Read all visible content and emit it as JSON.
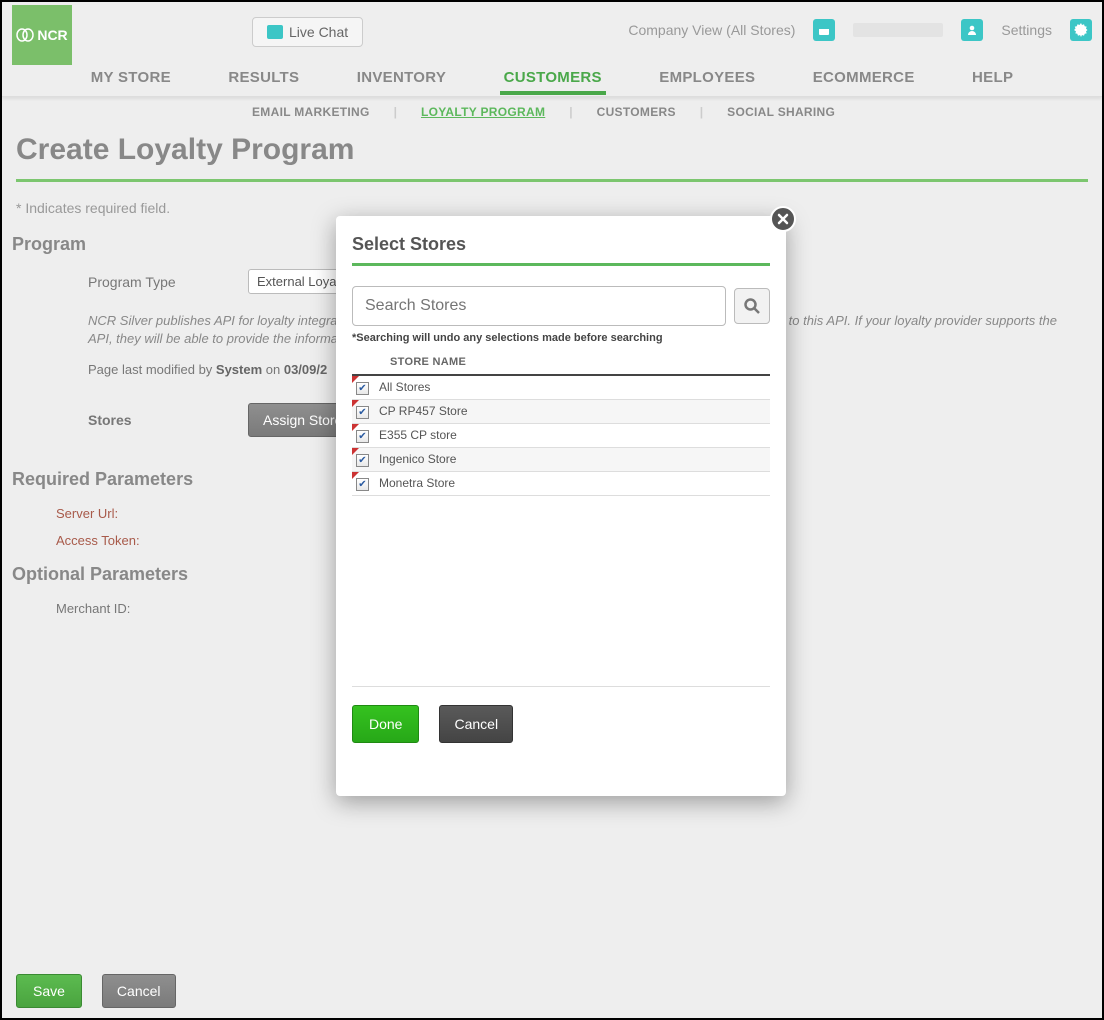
{
  "brand": "NCR",
  "live_chat_label": "Live Chat",
  "top": {
    "company_view": "Company View (All Stores)",
    "settings": "Settings"
  },
  "main_nav": {
    "items": [
      "MY STORE",
      "RESULTS",
      "INVENTORY",
      "CUSTOMERS",
      "EMPLOYEES",
      "ECOMMERCE",
      "HELP"
    ],
    "active_index": 3
  },
  "sub_nav": {
    "items": [
      "EMAIL MARKETING",
      "LOYALTY PROGRAM",
      "CUSTOMERS",
      "SOCIAL SHARING"
    ],
    "active_index": 1
  },
  "page_title": "Create Loyalty Program",
  "required_note": "* Indicates required field.",
  "sections": {
    "program": "Program",
    "required_params": "Required Parameters",
    "optional_params": "Optional Parameters"
  },
  "form": {
    "program_type_label": "Program Type",
    "program_type_value": "External Loyalt",
    "api_note": "NCR Silver publishes API for loyalty integration. Any third-party loyalty provider can provide loyalty services by integrating to this API. If your loyalty provider supports the API, they will be able to provide the information needed here. If not, then this is the API information to provide to them.",
    "last_mod_prefix": "Page last modified by ",
    "last_mod_user": "System",
    "last_mod_on": " on ",
    "last_mod_date": "03/09/2",
    "stores_label": "Stores",
    "assign_stores_label": "Assign Stores",
    "server_url_label": "Server Url:",
    "access_token_label": "Access Token:",
    "merchant_id_label": "Merchant ID:"
  },
  "bottom": {
    "save": "Save",
    "cancel": "Cancel"
  },
  "modal": {
    "title": "Select Stores",
    "search_placeholder": "Search Stores",
    "search_note": "*Searching will undo any selections made before searching",
    "column_header": "STORE NAME",
    "stores": [
      {
        "name": "All Stores",
        "checked": true
      },
      {
        "name": "CP RP457 Store",
        "checked": true
      },
      {
        "name": "E355 CP store",
        "checked": true
      },
      {
        "name": "Ingenico Store",
        "checked": true
      },
      {
        "name": "Monetra Store",
        "checked": true
      }
    ],
    "done": "Done",
    "cancel": "Cancel"
  }
}
